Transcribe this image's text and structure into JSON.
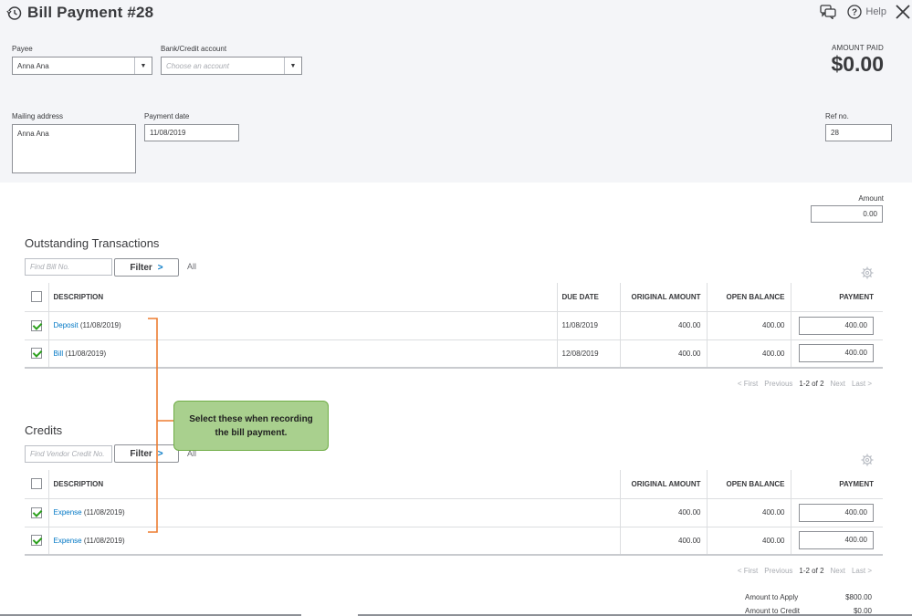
{
  "header": {
    "title": "Bill Payment #28",
    "help_label": "Help",
    "payee": {
      "label": "Payee",
      "value": "Anna Ana"
    },
    "bank_account": {
      "label": "Bank/Credit account",
      "placeholder": "Choose an account"
    },
    "amount_paid": {
      "label": "AMOUNT PAID",
      "value": "$0.00"
    },
    "mailing_address": {
      "label": "Mailing address",
      "value": "Anna Ana"
    },
    "payment_date": {
      "label": "Payment date",
      "value": "11/08/2019"
    },
    "ref_no": {
      "label": "Ref no.",
      "value": "28"
    }
  },
  "amount_field": {
    "label": "Amount",
    "value": "0.00"
  },
  "outstanding": {
    "title": "Outstanding Transactions",
    "find_placeholder": "Find Bill No.",
    "filter_label": "Filter",
    "all_label": "All",
    "columns": [
      "DESCRIPTION",
      "DUE DATE",
      "ORIGINAL AMOUNT",
      "OPEN BALANCE",
      "PAYMENT"
    ],
    "rows": [
      {
        "checked": true,
        "type": "Deposit",
        "date": "(11/08/2019)",
        "due_date": "11/08/2019",
        "original": "400.00",
        "open": "400.00",
        "payment": "400.00"
      },
      {
        "checked": true,
        "type": "Bill",
        "date": "(11/08/2019)",
        "due_date": "12/08/2019",
        "original": "400.00",
        "open": "400.00",
        "payment": "400.00"
      }
    ],
    "pager": {
      "first": "< First",
      "previous": "Previous",
      "range": "1-2 of 2",
      "next": "Next",
      "last": "Last >"
    }
  },
  "credits": {
    "title": "Credits",
    "find_placeholder": "Find Vendor Credit No.",
    "filter_label": "Filter",
    "all_label": "All",
    "columns": [
      "DESCRIPTION",
      "ORIGINAL AMOUNT",
      "OPEN BALANCE",
      "PAYMENT"
    ],
    "rows": [
      {
        "checked": true,
        "type": "Expense",
        "date": "(11/08/2019)",
        "original": "400.00",
        "open": "400.00",
        "payment": "400.00"
      },
      {
        "checked": true,
        "type": "Expense",
        "date": "(11/08/2019)",
        "original": "400.00",
        "open": "400.00",
        "payment": "400.00"
      }
    ],
    "pager": {
      "first": "< First",
      "previous": "Previous",
      "range": "1-2 of 2",
      "next": "Next",
      "last": "Last >"
    }
  },
  "totals": {
    "amount_to_apply_label": "Amount to Apply",
    "amount_to_apply": "$800.00",
    "amount_to_credit_label": "Amount to Credit",
    "amount_to_credit": "$0.00"
  },
  "annotation": {
    "callout_text": "Select these when recording the bill payment.",
    "colors": {
      "callout_fill": "#a9d08e",
      "bracket": "#ed7d31"
    }
  },
  "colors": {
    "link": "#0077c5",
    "check": "#2ca01c",
    "header_bg": "#f4f5f8"
  }
}
